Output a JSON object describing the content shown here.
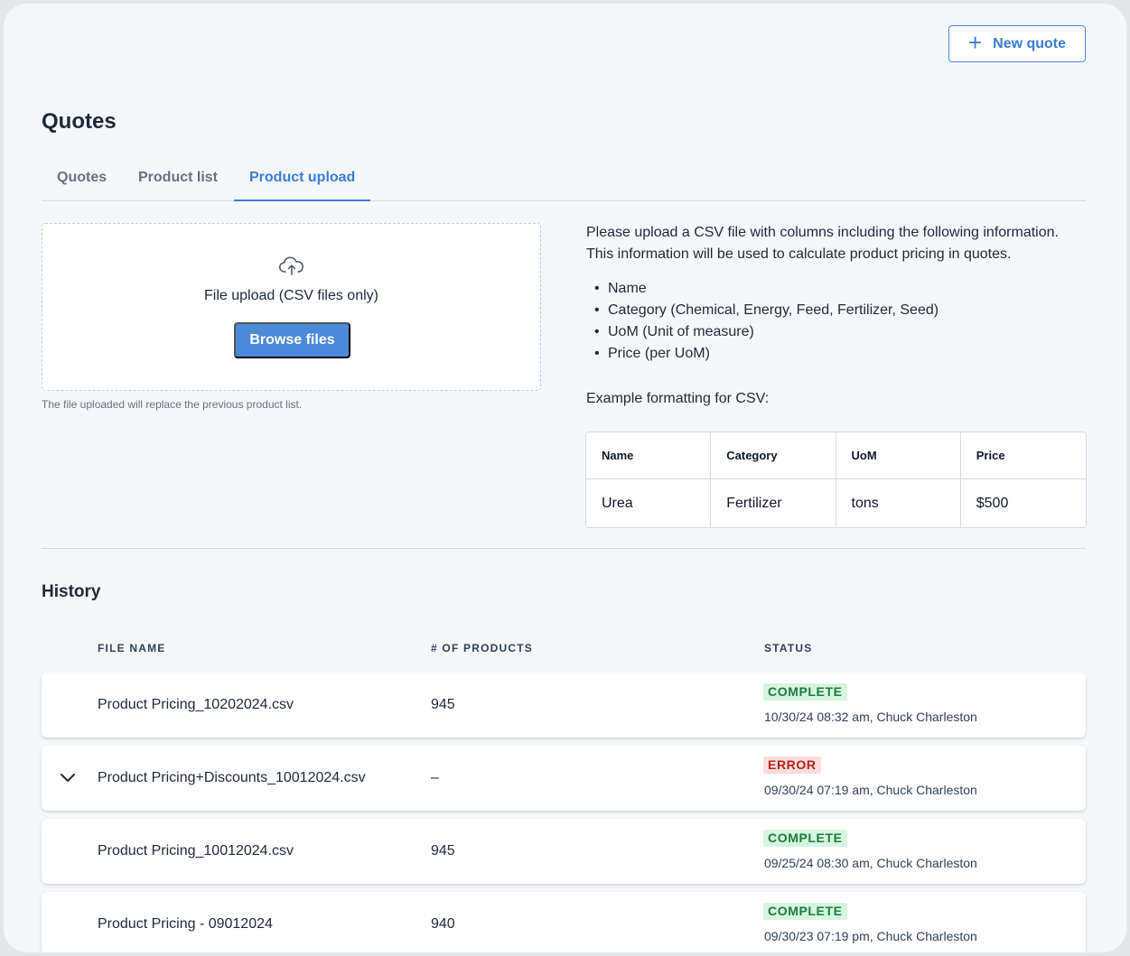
{
  "header": {
    "new_quote_icon": "plus-icon",
    "new_quote_label": "New quote"
  },
  "page": {
    "title": "Quotes"
  },
  "tabs": [
    {
      "label": "Quotes",
      "active": false
    },
    {
      "label": "Product list",
      "active": false
    },
    {
      "label": "Product upload",
      "active": true
    }
  ],
  "upload": {
    "icon": "cloud-upload-icon",
    "label": "File upload (CSV files only)",
    "browse_label": "Browse files",
    "note": "The file uploaded will replace the previous product list."
  },
  "info": {
    "line1": "Please upload a CSV file with columns including the following information.",
    "line2": "This information will be used to calculate product pricing in quotes.",
    "bullets": [
      "Name",
      "Category (Chemical, Energy, Feed, Fertilizer, Seed)",
      "UoM (Unit of measure)",
      "Price (per UoM)"
    ],
    "example_label": "Example formatting for CSV:",
    "example_table": {
      "headers": [
        "Name",
        "Category",
        "UoM",
        "Price"
      ],
      "row": [
        "Urea",
        "Fertilizer",
        "tons",
        "$500"
      ]
    }
  },
  "history": {
    "title": "History",
    "columns": {
      "file_name": "FILE NAME",
      "products": "# OF PRODUCTS",
      "status": "STATUS"
    },
    "rows": [
      {
        "file": "Product Pricing_10202024.csv",
        "products": "945",
        "status": "COMPLETE",
        "meta": "10/30/24 08:32 am, Chuck Charleston",
        "expandable": false
      },
      {
        "file": "Product Pricing+Discounts_10012024.csv",
        "products": "–",
        "status": "ERROR",
        "meta": "09/30/24 07:19 am, Chuck Charleston",
        "expandable": true
      },
      {
        "file": "Product Pricing_10012024.csv",
        "products": "945",
        "status": "COMPLETE",
        "meta": "09/25/24 08:30 am, Chuck Charleston",
        "expandable": false
      },
      {
        "file": "Product Pricing - 09012024",
        "products": "940",
        "status": "COMPLETE",
        "meta": "09/30/23 07:19 pm, Chuck Charleston",
        "expandable": false
      }
    ]
  },
  "colors": {
    "accent": "#4a8ad8",
    "complete_bg": "#d5f5de",
    "complete_text": "#1e7a3d",
    "error_bg": "#fbdcdc",
    "error_text": "#b42318"
  }
}
